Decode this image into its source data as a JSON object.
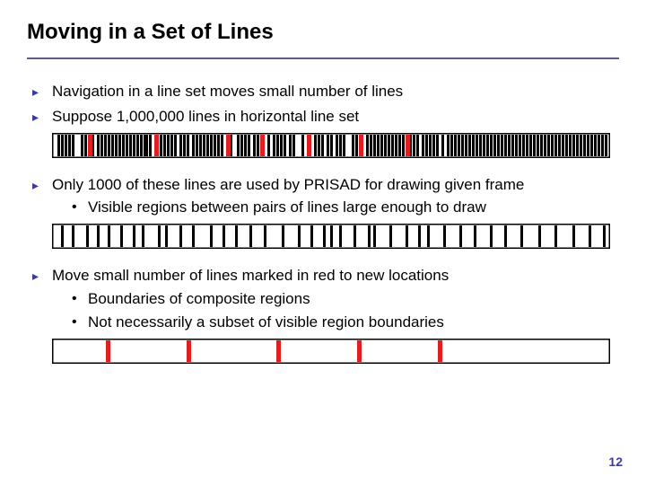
{
  "slide": {
    "title": "Moving in a Set of Lines",
    "bullet1": "Navigation in a line set moves small number of lines",
    "bullet2": "Suppose 1,000,000 lines in horizontal line set",
    "bullet3": "Only 1000 of these lines are used by PRISAD for drawing given frame",
    "bullet3_sub1": "Visible regions between pairs of lines large enough to draw",
    "bullet4": "Move small number of lines marked in red to new locations",
    "bullet4_sub1": "Boundaries of composite regions",
    "bullet4_sub2": "Not necessarily a subset of visible region boundaries",
    "page_number": "12"
  },
  "chart_data": [
    {
      "type": "bar",
      "title": "1,000,000-line set (dense) with marked lines",
      "xlim": [
        0,
        622
      ],
      "height": 28,
      "black_lines": [
        6,
        10,
        14,
        18,
        22,
        32,
        36,
        44,
        50,
        54,
        58,
        62,
        66,
        70,
        74,
        78,
        82,
        86,
        90,
        94,
        98,
        102,
        104,
        108,
        120,
        124,
        128,
        132,
        136,
        142,
        146,
        150,
        156,
        160,
        164,
        168,
        172,
        176,
        180,
        184,
        188,
        194,
        198,
        206,
        210,
        214,
        218,
        224,
        228,
        240,
        246,
        250,
        254,
        258,
        264,
        268,
        278,
        286,
        292,
        296,
        300,
        306,
        310,
        316,
        320,
        324,
        334,
        338,
        344,
        350,
        354,
        358,
        362,
        366,
        370,
        374,
        378,
        382,
        386,
        390,
        398,
        402,
        406,
        412,
        416,
        420,
        424,
        428,
        434,
        440,
        444,
        448,
        452,
        456,
        460,
        464,
        468,
        472,
        476,
        480,
        484,
        488,
        492,
        496,
        500,
        504,
        508,
        512,
        516,
        520,
        524,
        528,
        532,
        536,
        540,
        544,
        548,
        552,
        556,
        560,
        564,
        568,
        572,
        576,
        580,
        584,
        588,
        592,
        596,
        600,
        604,
        608,
        612,
        616
      ],
      "red_lines": [
        40,
        114,
        194,
        232,
        284,
        342,
        394
      ]
    },
    {
      "type": "bar",
      "title": "1000 visible PRISAD lines (sparse subset)",
      "xlim": [
        0,
        622
      ],
      "height": 28,
      "black_lines": [
        10,
        22,
        38,
        50,
        62,
        76,
        90,
        100,
        118,
        126,
        142,
        156,
        176,
        190,
        204,
        220,
        236,
        256,
        274,
        288,
        302,
        310,
        320,
        336,
        352,
        358,
        376,
        394,
        408,
        418,
        436,
        454,
        470,
        488,
        504,
        522,
        542,
        560,
        580,
        598,
        614
      ],
      "red_lines": []
    },
    {
      "type": "bar",
      "title": "Small number of marked lines moved",
      "xlim": [
        0,
        622
      ],
      "height": 28,
      "black_lines": [],
      "red_lines": [
        60,
        150,
        250,
        340,
        430
      ]
    }
  ]
}
